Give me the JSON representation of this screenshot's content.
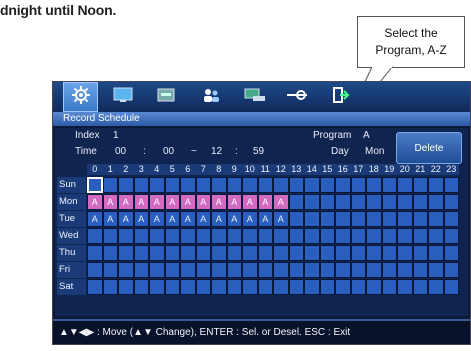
{
  "caption": "dnight until Noon.",
  "callout": {
    "line1": "Select the",
    "line2": "Program, A-Z"
  },
  "tabs": [
    {
      "icon": "gear-icon",
      "active": true
    },
    {
      "icon": "monitor-icon",
      "active": false
    },
    {
      "icon": "hdd-icon",
      "active": false
    },
    {
      "icon": "users-icon",
      "active": false
    },
    {
      "icon": "network-icon",
      "active": false
    },
    {
      "icon": "settings-slider-icon",
      "active": false
    },
    {
      "icon": "exit-icon",
      "active": false
    }
  ],
  "title": "Record Schedule",
  "info": {
    "index_label": "Index",
    "index_value": "1",
    "program_label": "Program",
    "program_value": "A",
    "time_label": "Time",
    "time_h1": "00",
    "sep1": ":",
    "time_m1": "00",
    "dash": "~",
    "time_h2": "12",
    "sep2": ":",
    "time_m2": "59",
    "day_label": "Day",
    "day_value": "Mon",
    "delete_label": "Delete"
  },
  "hours": [
    "0",
    "1",
    "2",
    "3",
    "4",
    "5",
    "6",
    "7",
    "8",
    "9",
    "10",
    "11",
    "12",
    "13",
    "14",
    "15",
    "16",
    "17",
    "18",
    "19",
    "20",
    "21",
    "22",
    "23"
  ],
  "days": [
    "Sun",
    "Mon",
    "Tue",
    "Wed",
    "Thu",
    "Fri",
    "Sat"
  ],
  "schedule": {
    "Sun": [],
    "Mon": [
      "A",
      "A",
      "A",
      "A",
      "A",
      "A",
      "A",
      "A",
      "A",
      "A",
      "A",
      "A",
      "A"
    ],
    "Tue": [
      "A",
      "A",
      "A",
      "A",
      "A",
      "A",
      "A",
      "A",
      "A",
      "A",
      "A",
      "A",
      "A"
    ],
    "Wed": [],
    "Thu": [],
    "Fri": [],
    "Sat": []
  },
  "highlight_row": "Mon",
  "cursor": {
    "day": "Sun",
    "hour": 0
  },
  "colors": {
    "pink": "#d36ac2",
    "cell": "#2b5fbf"
  },
  "help": "▲▼◀▶ : Move (▲▼ Change), ENTER : Sel. or Desel. ESC : Exit"
}
